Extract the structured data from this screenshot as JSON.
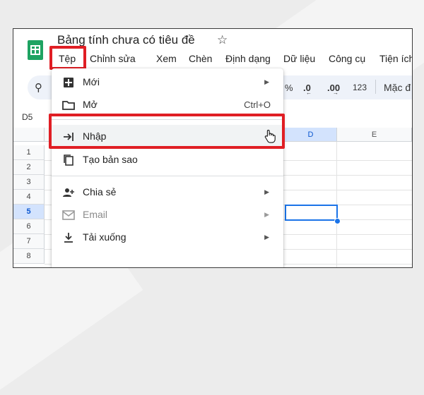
{
  "document": {
    "title": "Bảng tính chưa có tiêu đề",
    "star_icon": "star-outline-icon",
    "app_icon": "google-sheets-icon"
  },
  "menubar": [
    "Tệp",
    "Chỉnh sửa",
    "Xem",
    "Chèn",
    "Định dạng",
    "Dữ liệu",
    "Công cụ",
    "Tiện ích m"
  ],
  "toolbar": {
    "percent": "%",
    "decrease_decimal": ".0",
    "increase_decimal": ".00",
    "number_format": "123",
    "default_font": "Mặc đ"
  },
  "cell_reference": "D5",
  "sheet": {
    "columns": [
      "D",
      "E"
    ],
    "rows": [
      "1",
      "2",
      "3",
      "4",
      "5",
      "6",
      "7",
      "8"
    ],
    "selected_cell": "D5"
  },
  "file_menu": {
    "items": [
      {
        "label": "Mới",
        "icon": "new-sheet-icon",
        "submenu": true
      },
      {
        "label": "Mở",
        "icon": "folder-icon",
        "shortcut": "Ctrl+O"
      },
      {
        "label": "Nhập",
        "icon": "import-icon",
        "hovered": true
      },
      {
        "label": "Tạo bản sao",
        "icon": "copy-icon"
      },
      {
        "label": "Chia sẻ",
        "icon": "share-person-add-icon",
        "submenu": true
      },
      {
        "label": "Email",
        "icon": "email-icon",
        "submenu": true,
        "disabled": true
      },
      {
        "label": "Tải xuống",
        "icon": "download-icon",
        "submenu": true
      }
    ]
  },
  "highlight_color": "#e01e24",
  "accent_color": "#1a73e8"
}
